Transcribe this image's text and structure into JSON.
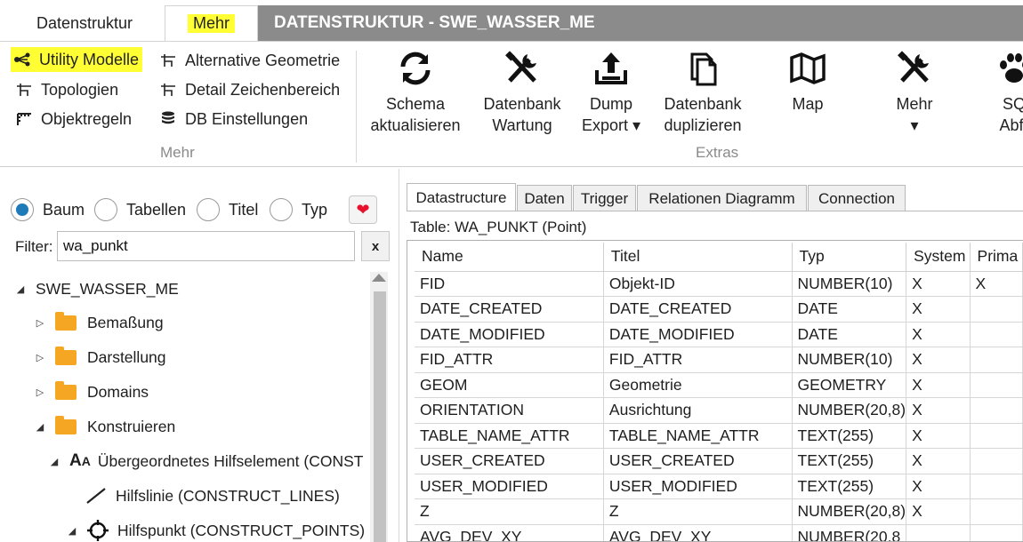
{
  "tabs": {
    "datenstruktur": "Datenstruktur",
    "mehr": "Mehr"
  },
  "window_title": "DATENSTRUKTUR - SWE_WASSER_ME",
  "ribbon": {
    "mehr_group": {
      "label": "Mehr",
      "items": {
        "utility": "Utility Modelle",
        "topologien": "Topologien",
        "objektregeln": "Objektregeln",
        "altgeom": "Alternative Geometrie",
        "detail": "Detail Zeichenbereich",
        "dbeinst": "DB Einstellungen"
      }
    },
    "extras_group": {
      "label": "Extras",
      "buttons": {
        "schema": [
          "Schema",
          "aktualisieren"
        ],
        "wartung": [
          "Datenbank",
          "Wartung"
        ],
        "dump": [
          "Dump",
          "Export ▾"
        ],
        "duplizieren": [
          "Datenbank",
          "duplizieren"
        ],
        "map": [
          "Map",
          ""
        ],
        "mehr": [
          "Mehr",
          "▾"
        ],
        "sql": [
          "SQ",
          "Abfr"
        ]
      }
    }
  },
  "left": {
    "radios": {
      "baum": "Baum",
      "tabellen": "Tabellen",
      "titel": "Titel",
      "typ": "Typ"
    },
    "filter_label": "Filter:",
    "filter_value": "wa_punkt",
    "filter_clear": "x",
    "tree": {
      "root": "SWE_WASSER_ME",
      "bemassung": "Bemaßung",
      "darstellung": "Darstellung",
      "domains": "Domains",
      "konstruieren": "Konstruieren",
      "hilfselement": "Übergeordnetes Hilfselement (CONST",
      "hilfslinie": "Hilfslinie (CONSTRUCT_LINES)",
      "hilfspunkt": "Hilfspunkt (CONSTRUCT_POINTS)"
    }
  },
  "right": {
    "tabs": {
      "datastructure": "Datastructure",
      "daten": "Daten",
      "trigger": "Trigger",
      "relationen": "Relationen Diagramm",
      "connection": "Connection"
    },
    "caption": "Table: WA_PUNKT (Point)",
    "columns": [
      "Name",
      "Titel",
      "Typ",
      "System",
      "Prima"
    ],
    "rows": [
      [
        "FID",
        "Objekt-ID",
        "NUMBER(10)",
        "X",
        "X"
      ],
      [
        "DATE_CREATED",
        "DATE_CREATED",
        "DATE",
        "X",
        ""
      ],
      [
        "DATE_MODIFIED",
        "DATE_MODIFIED",
        "DATE",
        "X",
        ""
      ],
      [
        "FID_ATTR",
        "FID_ATTR",
        "NUMBER(10)",
        "X",
        ""
      ],
      [
        "GEOM",
        "Geometrie",
        "GEOMETRY",
        "X",
        ""
      ],
      [
        "ORIENTATION",
        "Ausrichtung",
        "NUMBER(20,8)",
        "X",
        ""
      ],
      [
        "TABLE_NAME_ATTR",
        "TABLE_NAME_ATTR",
        "TEXT(255)",
        "X",
        ""
      ],
      [
        "USER_CREATED",
        "USER_CREATED",
        "TEXT(255)",
        "X",
        ""
      ],
      [
        "USER_MODIFIED",
        "USER_MODIFIED",
        "TEXT(255)",
        "X",
        ""
      ],
      [
        "Z",
        "Z",
        "NUMBER(20,8)",
        "X",
        ""
      ],
      [
        "AVG_DEV_XY",
        "AVG_DEV_XY",
        "NUMBER(20,8",
        "",
        ""
      ]
    ]
  }
}
